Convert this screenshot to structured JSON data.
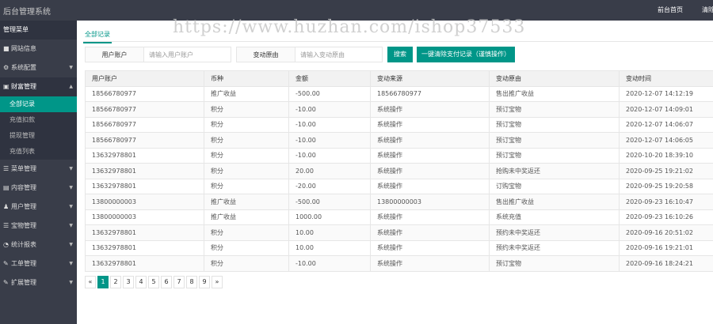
{
  "app": {
    "title": "后台管理系统"
  },
  "topnav": {
    "home": "前台首页",
    "clear": "清除缓存"
  },
  "watermark": "https://www.huzhan.com/ishop37533",
  "sidebar": {
    "header": "管理菜单",
    "items": [
      {
        "label": "网站信息",
        "icon": "info-icon",
        "glyph": "■",
        "caret": ""
      },
      {
        "label": "系统配置",
        "icon": "gear-icon",
        "glyph": "⚙",
        "caret": "▼"
      },
      {
        "label": "财富管理",
        "icon": "wallet-icon",
        "glyph": "▣",
        "caret": "▲"
      },
      {
        "label": "菜单管理",
        "icon": "list-icon",
        "glyph": "☰",
        "caret": "▼"
      },
      {
        "label": "内容管理",
        "icon": "content-icon",
        "glyph": "▤",
        "caret": "▼"
      },
      {
        "label": "用户管理",
        "icon": "users-icon",
        "glyph": "♟",
        "caret": "▼"
      },
      {
        "label": "宝物管理",
        "icon": "treasure-icon",
        "glyph": "☰",
        "caret": "▼"
      },
      {
        "label": "统计报表",
        "icon": "stats-icon",
        "glyph": "◔",
        "caret": "▼"
      },
      {
        "label": "工单管理",
        "icon": "wrench-icon",
        "glyph": "✎",
        "caret": "▼"
      },
      {
        "label": "扩展管理",
        "icon": "extension-icon",
        "glyph": "✎",
        "caret": "▼"
      }
    ],
    "subitems": [
      "全部记录",
      "充值扣款",
      "提现管理",
      "充值列表"
    ]
  },
  "tab": "全部记录",
  "filters": {
    "account_label": "用户账户",
    "account_placeholder": "请输入用户账户",
    "reason_label": "变动原由",
    "reason_placeholder": "请输入变动原由",
    "search_button": "搜索",
    "clear_button": "一键清除支付记录（谨慎操作）"
  },
  "table": {
    "headers": [
      "用户账户",
      "币种",
      "金额",
      "变动来源",
      "变动原由",
      "变动时间"
    ],
    "rows": [
      [
        "18566780977",
        "推广收益",
        "-500.00",
        "18566780977",
        "售出推广收益",
        "2020-12-07 14:12:19"
      ],
      [
        "18566780977",
        "积分",
        "-10.00",
        "系统操作",
        "预订宝物",
        "2020-12-07 14:09:01"
      ],
      [
        "18566780977",
        "积分",
        "-10.00",
        "系统操作",
        "预订宝物",
        "2020-12-07 14:06:07"
      ],
      [
        "18566780977",
        "积分",
        "-10.00",
        "系统操作",
        "预订宝物",
        "2020-12-07 14:06:05"
      ],
      [
        "13632978801",
        "积分",
        "-10.00",
        "系统操作",
        "预订宝物",
        "2020-10-20 18:39:10"
      ],
      [
        "13632978801",
        "积分",
        "20.00",
        "系统操作",
        "抢购未中奖返还",
        "2020-09-25 19:21:02"
      ],
      [
        "13632978801",
        "积分",
        "-20.00",
        "系统操作",
        "订购宝物",
        "2020-09-25 19:20:58"
      ],
      [
        "13800000003",
        "推广收益",
        "-500.00",
        "13800000003",
        "售出推广收益",
        "2020-09-23 16:10:47"
      ],
      [
        "13800000003",
        "推广收益",
        "1000.00",
        "系统操作",
        "系统充值",
        "2020-09-23 16:10:26"
      ],
      [
        "13632978801",
        "积分",
        "10.00",
        "系统操作",
        "预约未中奖返还",
        "2020-09-16 20:51:02"
      ],
      [
        "13632978801",
        "积分",
        "10.00",
        "系统操作",
        "预约未中奖返还",
        "2020-09-16 19:21:01"
      ],
      [
        "13632978801",
        "积分",
        "-10.00",
        "系统操作",
        "预订宝物",
        "2020-09-16 18:24:21"
      ]
    ]
  },
  "pagination": {
    "prev": "«",
    "next": "»",
    "pages": [
      "1",
      "2",
      "3",
      "4",
      "5",
      "6",
      "7",
      "8",
      "9"
    ],
    "current": "1"
  },
  "colors": {
    "accent": "#009688",
    "sidebar": "#393d49"
  }
}
